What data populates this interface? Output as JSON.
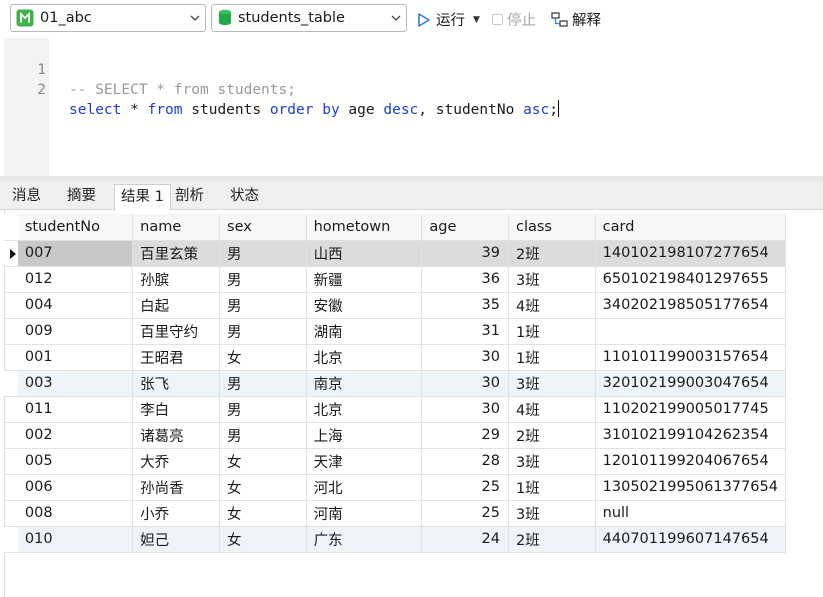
{
  "toolbar": {
    "database": "01_abc",
    "table": "students_table",
    "run_label": "运行",
    "stop_label": "停止",
    "explain_label": "解释"
  },
  "editor": {
    "lines": [
      {
        "number": "1",
        "text": "-- SELECT * from students;"
      },
      {
        "number": "2",
        "text": "select * from students order by age desc, studentNo asc;"
      }
    ],
    "line2_tokens": {
      "select": "select",
      "star": "*",
      "from": "from",
      "table": "students",
      "order": "order",
      "by": "by",
      "col1": "age",
      "desc": "desc",
      "comma": ",",
      "col2": "studentNo",
      "asc": "asc",
      "semi": ";"
    }
  },
  "tabs": [
    "消息",
    "摘要",
    "结果 1",
    "剖析",
    "状态"
  ],
  "active_tab": "结果 1",
  "grid": {
    "columns": [
      "studentNo",
      "name",
      "sex",
      "hometown",
      "age",
      "class",
      "card"
    ],
    "rows": [
      [
        "007",
        "百里玄策",
        "男",
        "山西",
        "39",
        "2班",
        "140102198107277654"
      ],
      [
        "012",
        "孙膑",
        "男",
        "新疆",
        "36",
        "3班",
        "650102198401297655"
      ],
      [
        "004",
        "白起",
        "男",
        "安徽",
        "35",
        "4班",
        "340202198505177654"
      ],
      [
        "009",
        "百里守约",
        "男",
        "湖南",
        "31",
        "1班",
        ""
      ],
      [
        "001",
        "王昭君",
        "女",
        "北京",
        "30",
        "1班",
        "110101199003157654"
      ],
      [
        "003",
        "张飞",
        "男",
        "南京",
        "30",
        "3班",
        "320102199003047654"
      ],
      [
        "011",
        "李白",
        "男",
        "北京",
        "30",
        "4班",
        "110202199005017745"
      ],
      [
        "002",
        "诸葛亮",
        "男",
        "上海",
        "29",
        "2班",
        "310102199104262354"
      ],
      [
        "005",
        "大乔",
        "女",
        "天津",
        "28",
        "3班",
        "120101199204067654"
      ],
      [
        "006",
        "孙尚香",
        "女",
        "河北",
        "25",
        "1班",
        "1305021995061377654"
      ],
      [
        "008",
        "小乔",
        "女",
        "河南",
        "25",
        "3班",
        "null"
      ],
      [
        "010",
        "妲己",
        "女",
        "广东",
        "24",
        "2班",
        "440701199607147654"
      ]
    ],
    "selected_row": 0,
    "highlighted_rows": [
      5,
      11
    ]
  },
  "colors": {
    "keyword": "#1b3fd1",
    "comment": "#9a9a9a",
    "run_icon": "#2f7fd8",
    "db_icon": "#3fb24a",
    "table_icon": "#23a847"
  }
}
